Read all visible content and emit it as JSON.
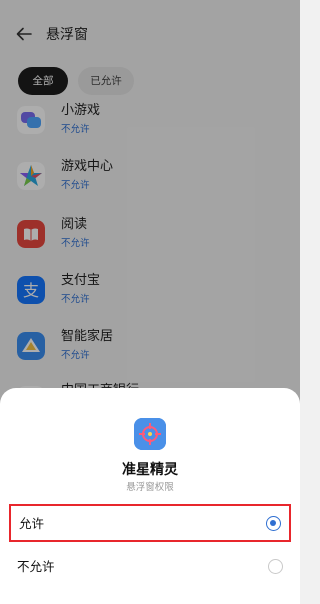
{
  "header": {
    "title": "悬浮窗",
    "back_icon": "arrow-left-icon"
  },
  "tabs": [
    {
      "label": "全部",
      "active": true
    },
    {
      "label": "已允许",
      "active": false
    }
  ],
  "apps": [
    {
      "name": "小游戏",
      "status": "不允许",
      "icon": "mini-game-icon"
    },
    {
      "name": "游戏中心",
      "status": "不允许",
      "icon": "game-center-icon"
    },
    {
      "name": "阅读",
      "status": "不允许",
      "icon": "reading-icon"
    },
    {
      "name": "支付宝",
      "status": "不允许",
      "icon": "alipay-icon"
    },
    {
      "name": "智能家居",
      "status": "不允许",
      "icon": "smart-home-icon"
    },
    {
      "name": "中国工商银行",
      "status": "",
      "icon": "icbc-icon"
    }
  ],
  "sheet": {
    "app_name": "准星精灵",
    "subtitle": "悬浮窗权限",
    "app_icon": "crosshair-app-icon",
    "options": [
      {
        "label": "允许",
        "selected": true
      },
      {
        "label": "不允许",
        "selected": false
      }
    ]
  },
  "colors": {
    "accent": "#2f6fd1",
    "highlight_border": "#e8262c",
    "active_tab_bg": "#1d1d1d"
  }
}
